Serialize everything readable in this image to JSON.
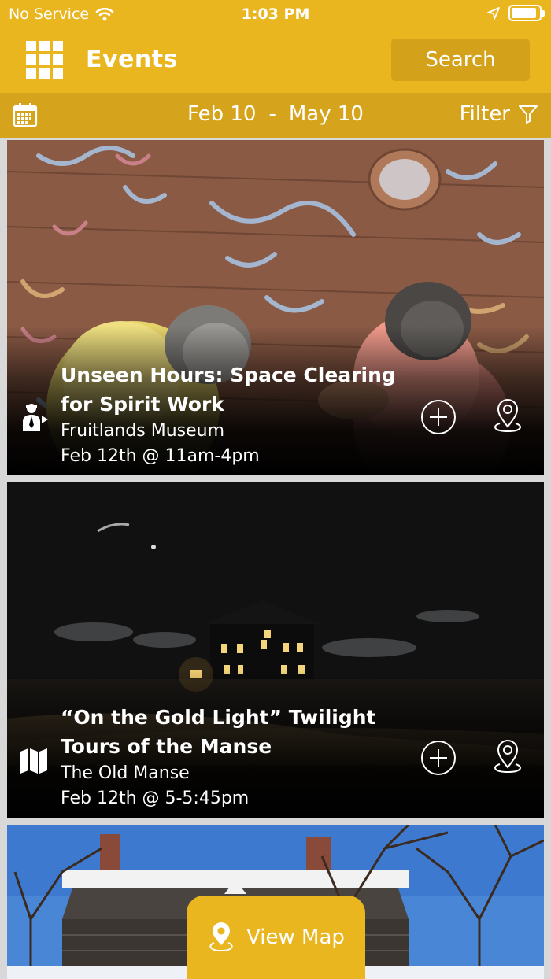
{
  "status_bar": {
    "carrier": "No Service",
    "time": "1:03 PM",
    "battery_level": 0.9
  },
  "header": {
    "title": "Events",
    "search_label": "Search"
  },
  "date_bar": {
    "start": "Feb 10",
    "separator": "-",
    "end": "May 10",
    "filter_label": "Filter"
  },
  "events": [
    {
      "title_line1": "Unseen Hours: Space Clearing",
      "title_line2": "for Spirit Work",
      "venue": "Fruitlands Museum",
      "date": "Feb 12th @ 11am-4pm",
      "type_icon": "guided-tour-icon"
    },
    {
      "title_line1": "“On the Gold Light” Twilight",
      "title_line2": "Tours of the Manse",
      "venue": "The Old Manse",
      "date": "Feb 12th @ 5-5:45pm",
      "type_icon": "map-icon"
    }
  ],
  "view_map_label": "View Map",
  "colors": {
    "brand": "#e9b620",
    "brand_dark": "#d6a41c",
    "search_button": "#d4a11a"
  }
}
